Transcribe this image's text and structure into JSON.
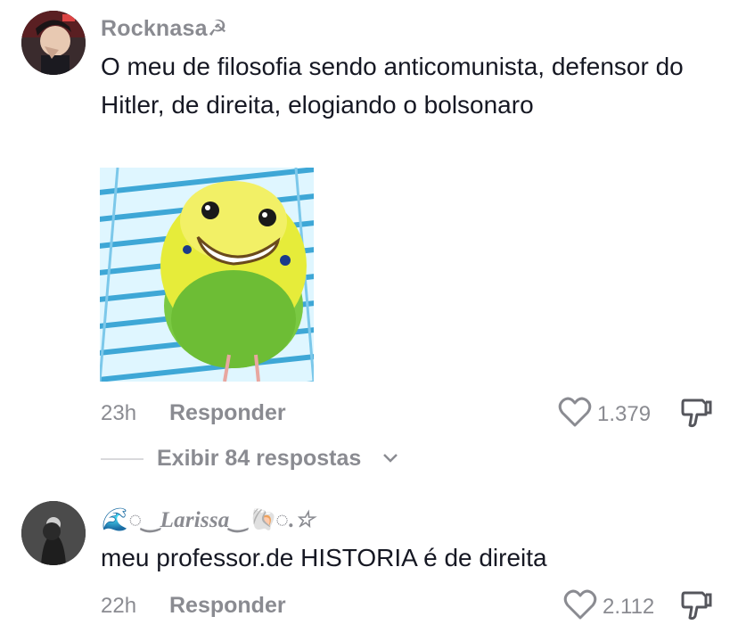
{
  "comments": [
    {
      "username": "Rocknasa☭",
      "text": "O meu de filosofia sendo anticomunista, defensor do Hitler, de direita, elogiando o bolsonaro",
      "time": "23h",
      "reply_label": "Responder",
      "likes": "1.379",
      "view_replies": "Exibir 84 respostas"
    },
    {
      "username": "🌊◌‿Larissa‿🐚◌.☆",
      "text": "meu professor.de HISTORIA é de direita",
      "time": "22h",
      "reply_label": "Responder",
      "likes": "2.112"
    }
  ],
  "icons": {
    "like": "heart-outline-icon",
    "dislike": "thumbs-down-icon",
    "expand": "chevron-down-icon"
  },
  "colors": {
    "text": "#161823",
    "muted": "#8a8b91",
    "background": "#ffffff"
  }
}
